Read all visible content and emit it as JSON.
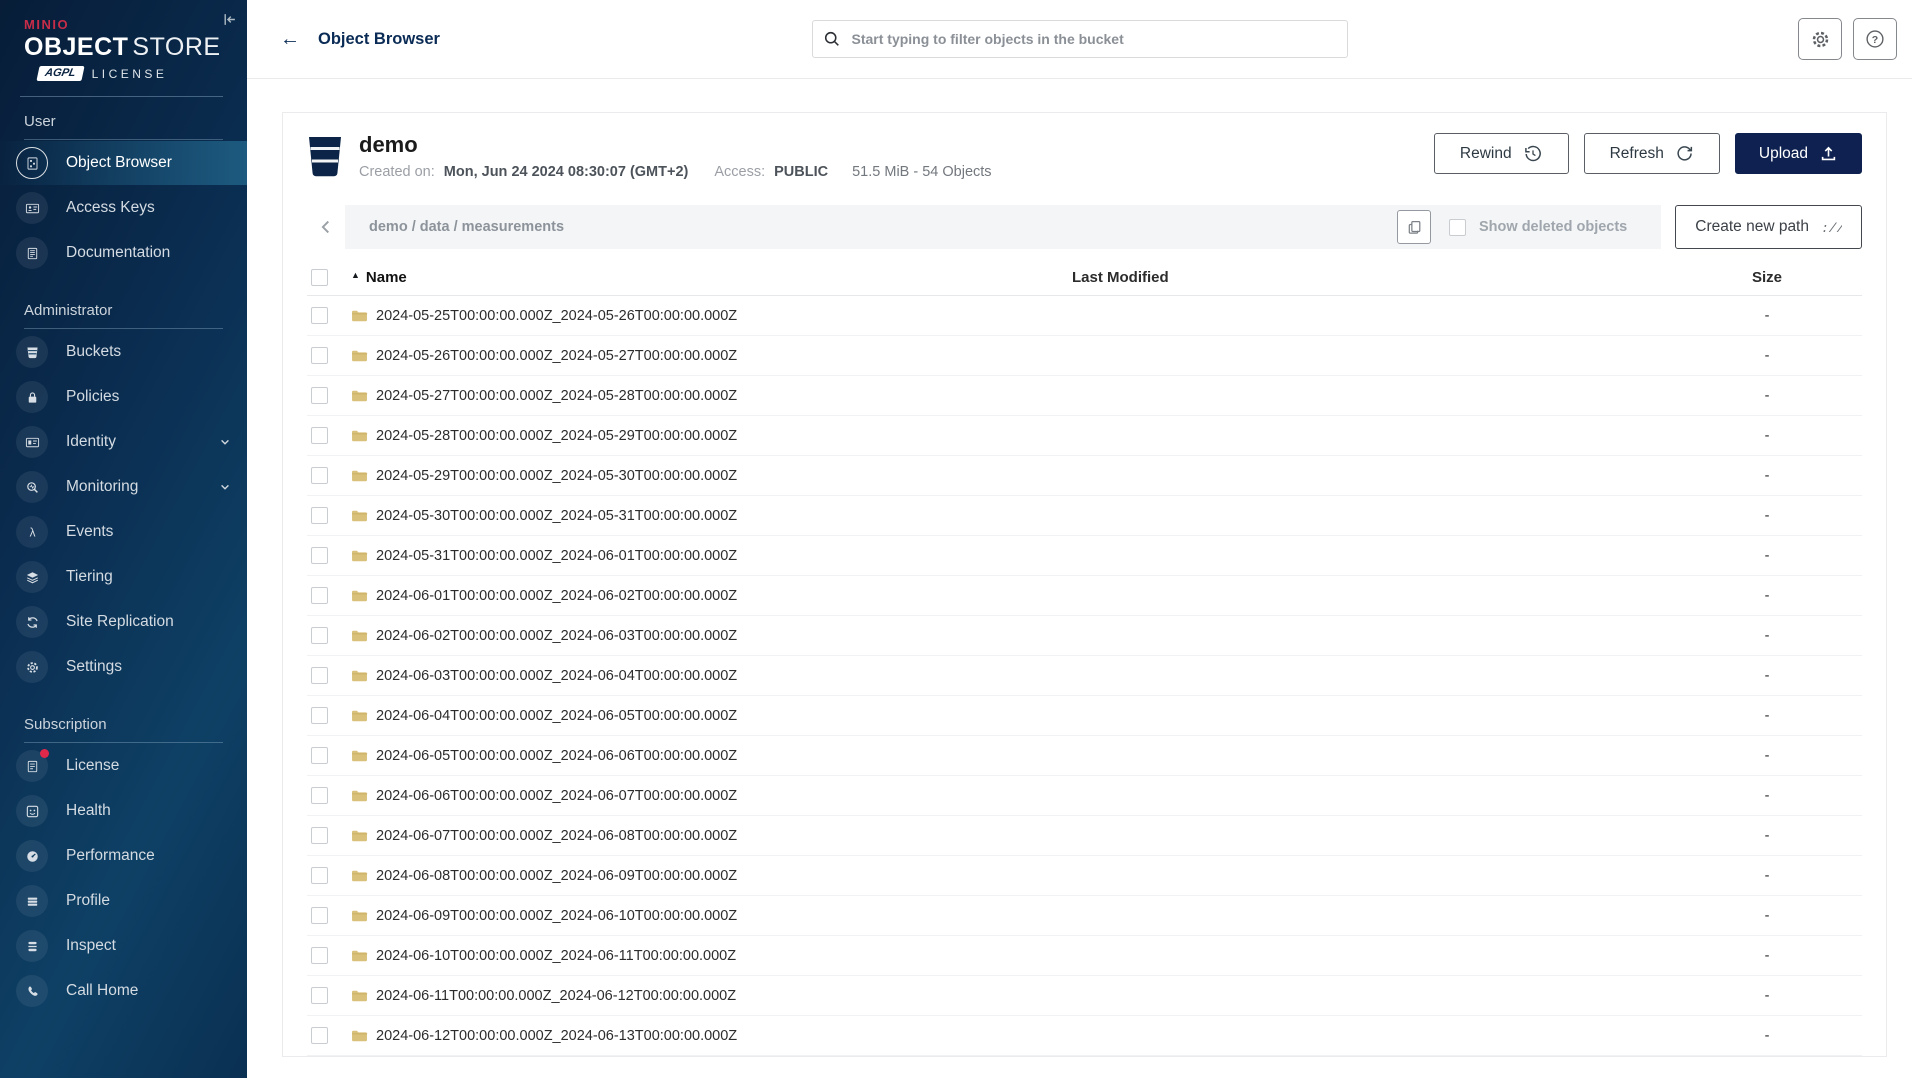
{
  "sidebar": {
    "logo": {
      "brand": "MINIO",
      "product_bold": "OBJECT",
      "product_light": "STORE",
      "badge": "AGPL",
      "badge_suffix": "LICENSE"
    },
    "sections": [
      {
        "label": "User",
        "items": [
          {
            "label": "Object Browser",
            "icon": "object-browser-icon",
            "slug": "object-browser",
            "active": true
          },
          {
            "label": "Access Keys",
            "icon": "access-keys-icon",
            "slug": "access-keys"
          },
          {
            "label": "Documentation",
            "icon": "documentation-icon",
            "slug": "documentation"
          }
        ]
      },
      {
        "label": "Administrator",
        "items": [
          {
            "label": "Buckets",
            "icon": "buckets-icon",
            "slug": "buckets"
          },
          {
            "label": "Policies",
            "icon": "policies-icon",
            "slug": "policies"
          },
          {
            "label": "Identity",
            "icon": "identity-icon",
            "slug": "identity",
            "expandable": true
          },
          {
            "label": "Monitoring",
            "icon": "monitoring-icon",
            "slug": "monitoring",
            "expandable": true
          },
          {
            "label": "Events",
            "icon": "events-icon",
            "slug": "events"
          },
          {
            "label": "Tiering",
            "icon": "tiering-icon",
            "slug": "tiering"
          },
          {
            "label": "Site Replication",
            "icon": "site-replication-icon",
            "slug": "site-replication"
          },
          {
            "label": "Settings",
            "icon": "settings-icon",
            "slug": "settings"
          }
        ]
      },
      {
        "label": "Subscription",
        "items": [
          {
            "label": "License",
            "icon": "license-icon",
            "slug": "license",
            "badge_color": "#e0294a"
          },
          {
            "label": "Health",
            "icon": "health-icon",
            "slug": "health"
          },
          {
            "label": "Performance",
            "icon": "performance-icon",
            "slug": "performance"
          },
          {
            "label": "Profile",
            "icon": "profile-icon",
            "slug": "profile"
          },
          {
            "label": "Inspect",
            "icon": "inspect-icon",
            "slug": "inspect"
          },
          {
            "label": "Call Home",
            "icon": "call-home-icon",
            "slug": "call-home"
          }
        ]
      }
    ]
  },
  "header": {
    "title": "Object Browser",
    "search_placeholder": "Start typing to filter objects in the bucket"
  },
  "bucket": {
    "name": "demo",
    "created_label": "Created on:",
    "created_value": "Mon, Jun 24 2024 08:30:07 (GMT+2)",
    "access_label": "Access:",
    "access_value": "PUBLIC",
    "summary": "51.5 MiB - 54 Objects",
    "actions": {
      "rewind": "Rewind",
      "refresh": "Refresh",
      "upload": "Upload"
    }
  },
  "browser": {
    "breadcrumb": "demo / data / measurements",
    "show_deleted_label": "Show deleted objects",
    "show_deleted_checked": false,
    "create_path_label": "Create new path"
  },
  "table": {
    "columns": [
      "Name",
      "Last Modified",
      "Size"
    ],
    "sort": {
      "column": "Name",
      "direction": "asc"
    },
    "rows": [
      {
        "name": "2024-05-25T00:00:00.000Z_2024-05-26T00:00:00.000Z",
        "last_modified": "",
        "size": "-"
      },
      {
        "name": "2024-05-26T00:00:00.000Z_2024-05-27T00:00:00.000Z",
        "last_modified": "",
        "size": "-"
      },
      {
        "name": "2024-05-27T00:00:00.000Z_2024-05-28T00:00:00.000Z",
        "last_modified": "",
        "size": "-"
      },
      {
        "name": "2024-05-28T00:00:00.000Z_2024-05-29T00:00:00.000Z",
        "last_modified": "",
        "size": "-"
      },
      {
        "name": "2024-05-29T00:00:00.000Z_2024-05-30T00:00:00.000Z",
        "last_modified": "",
        "size": "-"
      },
      {
        "name": "2024-05-30T00:00:00.000Z_2024-05-31T00:00:00.000Z",
        "last_modified": "",
        "size": "-"
      },
      {
        "name": "2024-05-31T00:00:00.000Z_2024-06-01T00:00:00.000Z",
        "last_modified": "",
        "size": "-"
      },
      {
        "name": "2024-06-01T00:00:00.000Z_2024-06-02T00:00:00.000Z",
        "last_modified": "",
        "size": "-"
      },
      {
        "name": "2024-06-02T00:00:00.000Z_2024-06-03T00:00:00.000Z",
        "last_modified": "",
        "size": "-"
      },
      {
        "name": "2024-06-03T00:00:00.000Z_2024-06-04T00:00:00.000Z",
        "last_modified": "",
        "size": "-"
      },
      {
        "name": "2024-06-04T00:00:00.000Z_2024-06-05T00:00:00.000Z",
        "last_modified": "",
        "size": "-"
      },
      {
        "name": "2024-06-05T00:00:00.000Z_2024-06-06T00:00:00.000Z",
        "last_modified": "",
        "size": "-"
      },
      {
        "name": "2024-06-06T00:00:00.000Z_2024-06-07T00:00:00.000Z",
        "last_modified": "",
        "size": "-"
      },
      {
        "name": "2024-06-07T00:00:00.000Z_2024-06-08T00:00:00.000Z",
        "last_modified": "",
        "size": "-"
      },
      {
        "name": "2024-06-08T00:00:00.000Z_2024-06-09T00:00:00.000Z",
        "last_modified": "",
        "size": "-"
      },
      {
        "name": "2024-06-09T00:00:00.000Z_2024-06-10T00:00:00.000Z",
        "last_modified": "",
        "size": "-"
      },
      {
        "name": "2024-06-10T00:00:00.000Z_2024-06-11T00:00:00.000Z",
        "last_modified": "",
        "size": "-"
      },
      {
        "name": "2024-06-11T00:00:00.000Z_2024-06-12T00:00:00.000Z",
        "last_modified": "",
        "size": "-"
      },
      {
        "name": "2024-06-12T00:00:00.000Z_2024-06-13T00:00:00.000Z",
        "last_modified": "",
        "size": "-"
      }
    ]
  },
  "colors": {
    "sidebar_navy": "#0a2c4f",
    "sidebar_active": "#1d5a7f",
    "accent_navy": "#0e2150",
    "brand_red": "#c72c48",
    "folder": "#d9c07b",
    "badge_red": "#e0294a"
  }
}
